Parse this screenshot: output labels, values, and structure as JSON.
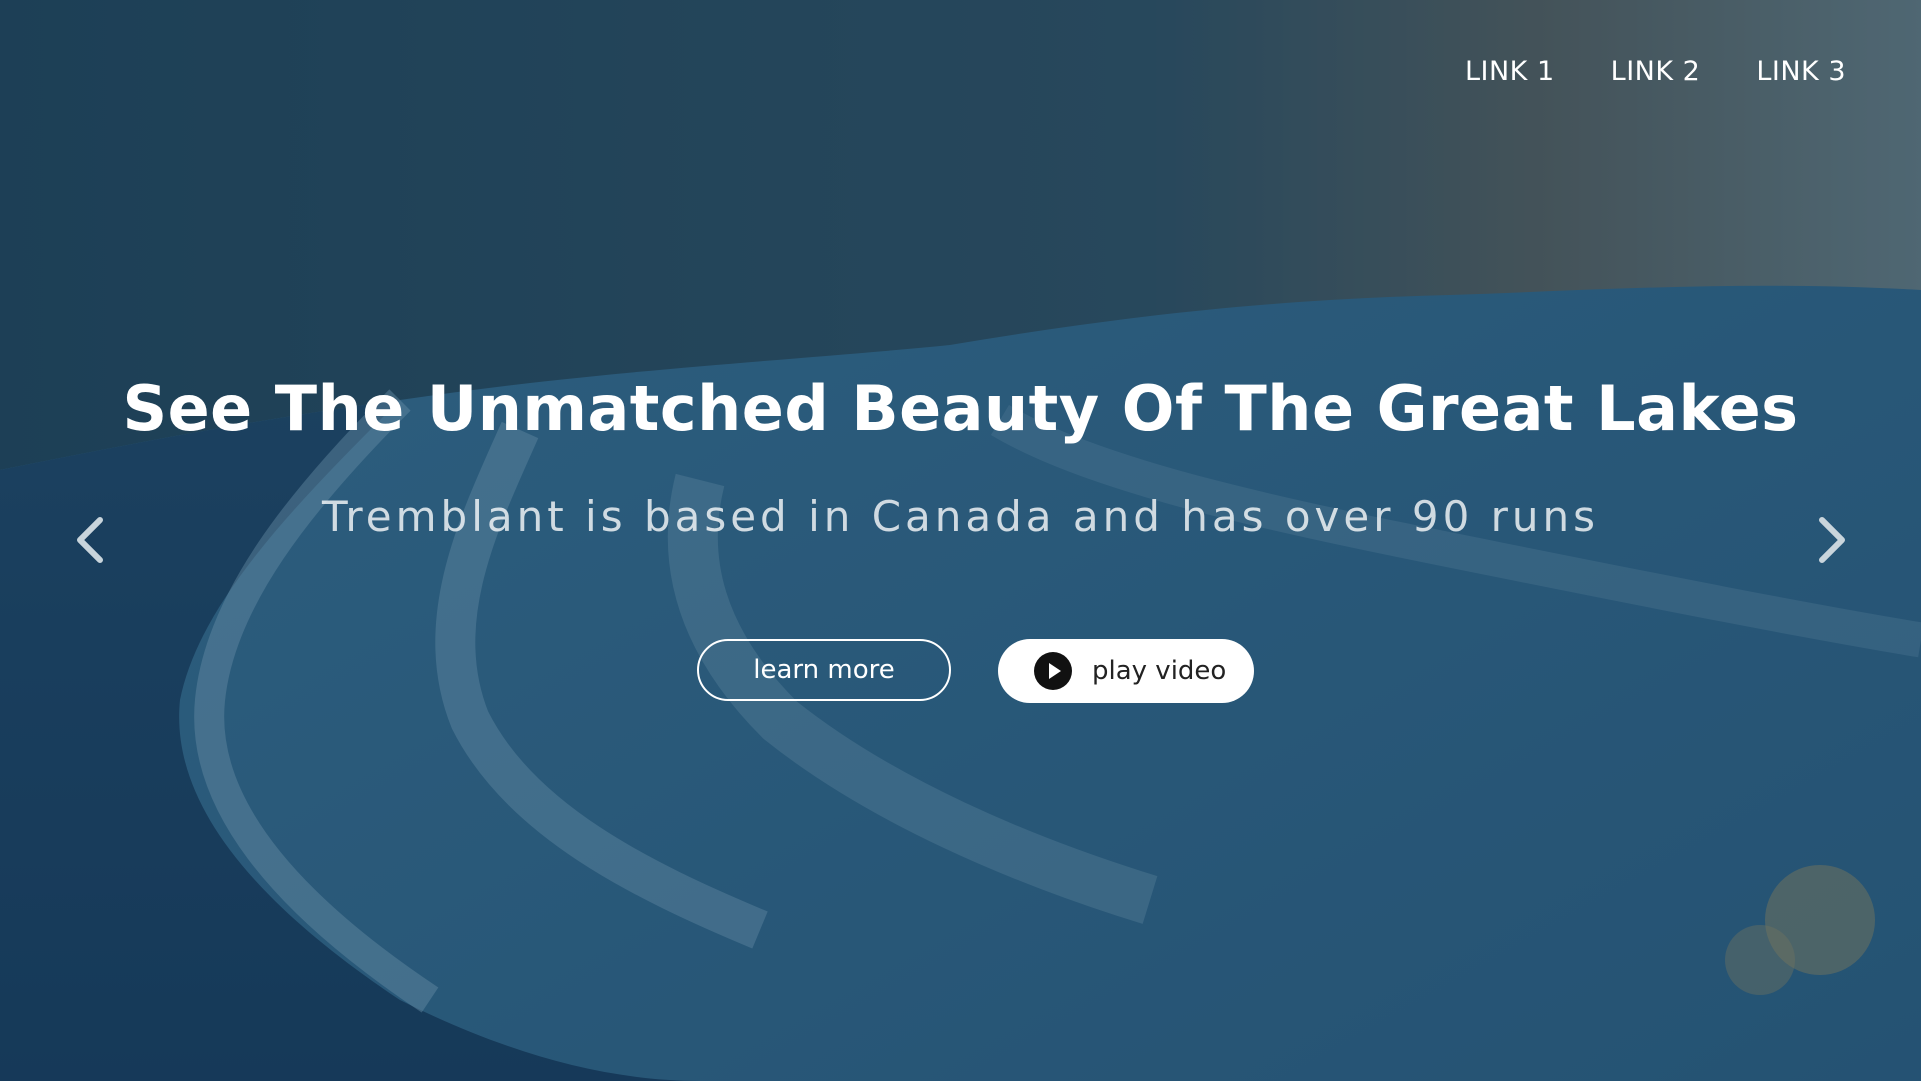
{
  "nav": {
    "links": [
      {
        "label": "LINK 1"
      },
      {
        "label": "LINK 2"
      },
      {
        "label": "LINK 3"
      }
    ]
  },
  "hero": {
    "headline": "See The Unmatched Beauty Of The Great Lakes",
    "subheadline": "Tremblant is based in Canada and has over 90 runs",
    "learn_more_label": "learn more",
    "play_video_label": "play video"
  },
  "carousel": {
    "prev_icon": "chevron-left-icon",
    "next_icon": "chevron-right-icon"
  },
  "colors": {
    "overlay": "#1e4560",
    "text": "#ffffff",
    "button_fill": "#ffffff",
    "play_icon": "#111111"
  }
}
